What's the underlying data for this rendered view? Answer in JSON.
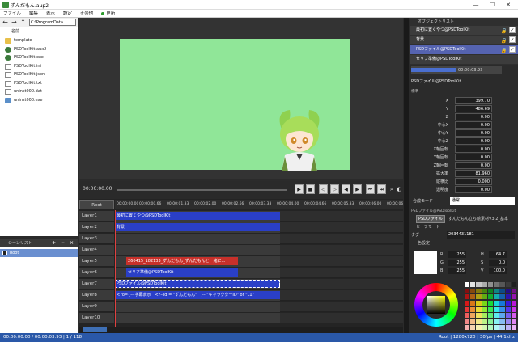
{
  "window": {
    "title": "ずんだもん.aup2",
    "minimize": "—",
    "maximize": "☐",
    "close": "✕"
  },
  "menu": {
    "items": [
      "ファイル",
      "編集",
      "表示",
      "設定",
      "その他"
    ],
    "update": "更新"
  },
  "explorer": {
    "path": "C:\\ProgramData",
    "column": "名前",
    "files": [
      {
        "name": "template",
        "icon": "folder-icon"
      },
      {
        "name": "PSDToolKit.aux2",
        "icon": "gear-icon"
      },
      {
        "name": "PSDToolKit.exe",
        "icon": "gear-icon"
      },
      {
        "name": "PSDToolKit.ini",
        "icon": "doc-icon"
      },
      {
        "name": "PSDToolKit.json",
        "icon": "doc-icon"
      },
      {
        "name": "PSDToolKit.txt",
        "icon": "doc-icon"
      },
      {
        "name": "uninst000.dat",
        "icon": "doc-icon"
      },
      {
        "name": "uninst000.exe",
        "icon": "exe-icon"
      }
    ]
  },
  "layer_panel": {
    "title": "シーンリスト",
    "add": "+",
    "remove": "−",
    "root": "Root"
  },
  "playbar": {
    "timecode": "00:00:00.00"
  },
  "timeline": {
    "root_label": "Root",
    "ruler": [
      "00:00:00.00",
      "00:00:00.66",
      "00:00:01.33",
      "00:00:02.00",
      "00:00:02.66",
      "00:00:03.33",
      "00:00:04.00",
      "00:00:04.66",
      "00:00:05.33",
      "00:00:06.00",
      "00:00:06.66"
    ],
    "layers": [
      "Layer1",
      "Layer2",
      "Layer3",
      "Layer4",
      "Layer5",
      "Layer6",
      "Layer7",
      "Layer8",
      "Layer9",
      "Layer10"
    ],
    "clips": {
      "layer1": "最初に置くやつ@PSDToolKit",
      "layer2": "背景",
      "layer5": "260415_182133_ずんだもん_ずんだもんと一緒に...",
      "layer6": "セリフ準備@PSDToolKit",
      "layer7": "PSDファイル@PSDToolKit",
      "layer8": "<?o={-- 字幕表示　<?--id = \"ずんだもん\"　,-- \"キャラクターID\" or \"L1\""
    }
  },
  "object_list": {
    "title": "オブジェクトリスト",
    "items": [
      "最初に置くやつ@PSDToolKit",
      "背景",
      "PSDファイル@PSDToolKit",
      "セリフ準備@PSDToolKit"
    ]
  },
  "object_property": {
    "time": "00:00:03.93",
    "name": "PSDファイル@PSDToolKit",
    "section": "標準",
    "params": [
      {
        "label": "X",
        "value": "399.70"
      },
      {
        "label": "Y",
        "value": "486.69"
      },
      {
        "label": "Z",
        "value": "0.00"
      },
      {
        "label": "中心X",
        "value": "0.00"
      },
      {
        "label": "中心Y",
        "value": "0.00"
      },
      {
        "label": "中心Z",
        "value": "0.00"
      },
      {
        "label": "X軸回転",
        "value": "0.00"
      },
      {
        "label": "Y軸回転",
        "value": "0.00"
      },
      {
        "label": "Z軸回転",
        "value": "0.00"
      },
      {
        "label": "拡大率",
        "value": "81.960"
      },
      {
        "label": "縦横比",
        "value": "0.000"
      },
      {
        "label": "透明度",
        "value": "0.00"
      }
    ],
    "blend_label": "合成モード",
    "blend_value": "通常",
    "psd_section": "PSDファイル@PSDToolKit",
    "psd_button": "PSDファイル",
    "psd_file": "ずんだもん立ち絵素材V3.2_基本",
    "save_mode": "セーフモード",
    "tag_label": "タグ",
    "tag_value": "2034431181"
  },
  "color_panel": {
    "title": "色設定",
    "r": "255",
    "g": "255",
    "b": "255",
    "h": "64.7",
    "s": "0.0",
    "v": "100.0"
  },
  "status": {
    "left": "00:00:00.00 / 00:00:03.93 | 1 / 118",
    "right": "Root | 1280x720 | 30fps | 44.1kHz"
  },
  "colors": {
    "accent": "#2a58a8",
    "canvas_bg": "#90e698",
    "clip_blue": "#2a3fc7",
    "clip_red": "#c8302a"
  }
}
